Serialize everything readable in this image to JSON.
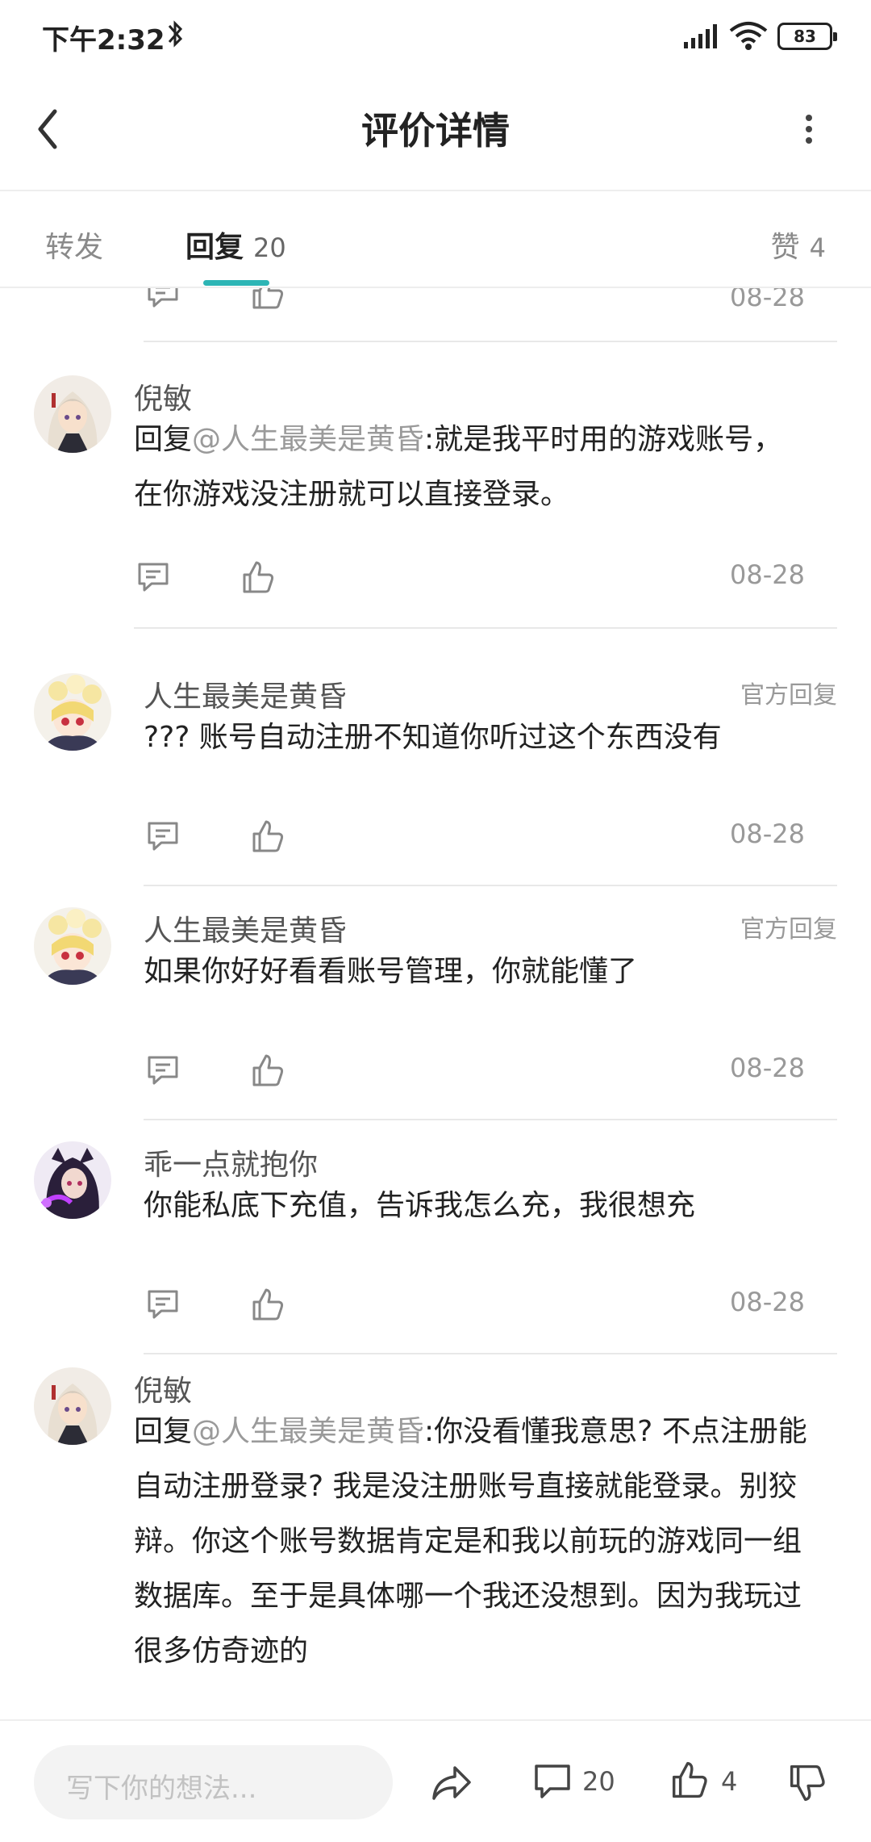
{
  "status_bar": {
    "time": "下午2:32",
    "battery": "83"
  },
  "header": {
    "title": "评价详情"
  },
  "tabs": {
    "repost": "转发",
    "reply": "回复",
    "reply_count": "20",
    "like": "赞",
    "like_count": "4"
  },
  "top_partial": {
    "date": "08-28"
  },
  "comments": [
    {
      "author": "倪敏",
      "avatar_icon": "avatar-white-hair-girl",
      "reply_prefix": "回复",
      "mention": "@人生最美是黄昏",
      "text": ":就是我平时用的游戏账号，在你游戏没注册就可以直接登录。",
      "date": "08-28"
    },
    {
      "author": "人生最美是黄昏",
      "avatar_icon": "avatar-flower-girl",
      "tag": "官方回复",
      "text": "??? 账号自动注册不知道你听过这个东西没有",
      "date": "08-28"
    },
    {
      "author": "人生最美是黄昏",
      "avatar_icon": "avatar-flower-girl",
      "tag": "官方回复",
      "text": "如果你好好看看账号管理，你就能懂了",
      "date": "08-28"
    },
    {
      "author": "乖一点就抱你",
      "avatar_icon": "avatar-dark-hair-girl",
      "text": "你能私底下充值，告诉我怎么充，我很想充",
      "date": "08-28"
    },
    {
      "author": "倪敏",
      "avatar_icon": "avatar-white-hair-girl",
      "reply_prefix": "回复",
      "mention": "@人生最美是黄昏",
      "text": ":你没看懂我意思? 不点注册能自动注册登录? 我是没注册账号直接就能登录。别狡辩。你这个账号数据肯定是和我以前玩的游戏同一组数据库。至于是具体哪一个我还没想到。因为我玩过很多仿奇迹的"
    }
  ],
  "bottom_bar": {
    "placeholder": "写下你的想法...",
    "comment_count": "20",
    "like_count": "4"
  },
  "colors": {
    "accent": "#2db5b5",
    "muted_text": "#999999",
    "mention": "#9a9a9a"
  }
}
